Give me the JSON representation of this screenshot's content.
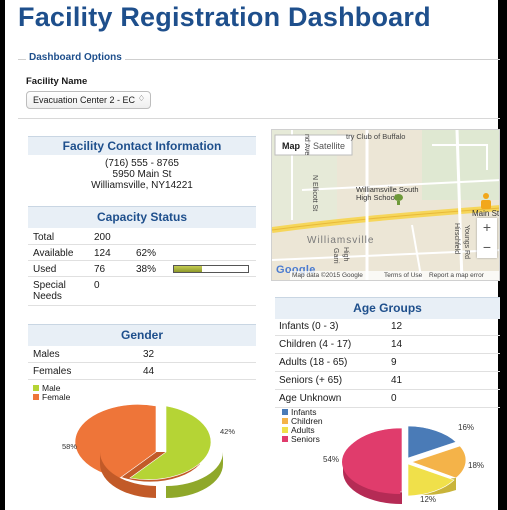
{
  "header": {
    "title": "Facility Registration Dashboard"
  },
  "options": {
    "legend": "Dashboard Options",
    "facility_label": "Facility Name",
    "facility_value": "Evacuation Center 2 - EC",
    "facility_caret": "♢"
  },
  "contact": {
    "title": "Facility Contact Information",
    "phone": "(716) 555 - 8765",
    "street": "5950 Main St",
    "city": "Williamsville, NY14221"
  },
  "capacity": {
    "title": "Capacity Status",
    "rows": [
      {
        "label": "Total",
        "value": "200",
        "percent": ""
      },
      {
        "label": "Available",
        "value": "124",
        "percent": "62%"
      },
      {
        "label": "Used",
        "value": "76",
        "percent": "38%",
        "fill": 0.38
      },
      {
        "label": "Special Needs",
        "value": "0",
        "percent": ""
      }
    ]
  },
  "gender": {
    "title": "Gender",
    "rows": [
      {
        "label": "Males",
        "value": "32"
      },
      {
        "label": "Females",
        "value": "44"
      }
    ],
    "legend": [
      {
        "label": "Male",
        "color": "#b5d435"
      },
      {
        "label": "Female",
        "color": "#ee7539"
      }
    ],
    "pie_labels": {
      "female": "58%",
      "male": "42%"
    }
  },
  "map": {
    "tab_map": "Map",
    "tab_satellite": "Satellite",
    "labels": {
      "club": "try Club of Buffalo",
      "school": "Williamsville South High School",
      "road": "N Ellicott St",
      "ave": "nd Ave",
      "town": "Williamsville",
      "main": "Main St",
      "youngs": "Youngs Rd",
      "hirsch": "Hirschfeld",
      "garri": "Garri",
      "high": "High"
    },
    "attribution": "Map data ©2015 Google",
    "terms": "Terms of Use",
    "report": "Report a map error",
    "zoom_in": "+",
    "zoom_out": "−",
    "google": "Google"
  },
  "age": {
    "title": "Age Groups",
    "rows": [
      {
        "label": "Infants (0 - 3)",
        "value": "12"
      },
      {
        "label": "Children (4 - 17)",
        "value": "14"
      },
      {
        "label": "Adults (18 - 65)",
        "value": "9"
      },
      {
        "label": "Seniors (+ 65)",
        "value": "41"
      },
      {
        "label": "Age Unknown",
        "value": "0"
      }
    ],
    "legend": [
      {
        "label": "Infants",
        "color": "#4a7bb7"
      },
      {
        "label": "Children",
        "color": "#f4b349"
      },
      {
        "label": "Adults",
        "color": "#f0e04a"
      },
      {
        "label": "Seniors",
        "color": "#e03c6c"
      }
    ],
    "pie_labels": {
      "infants": "16%",
      "children": "18%",
      "adults": "12%",
      "seniors": "54%"
    }
  }
}
